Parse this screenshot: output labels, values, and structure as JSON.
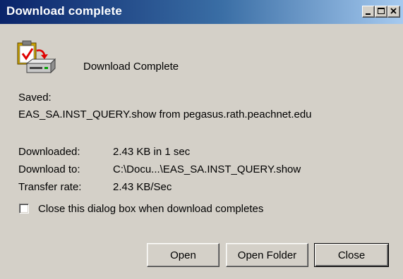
{
  "window": {
    "title": "Download complete"
  },
  "header": {
    "message": "Download Complete",
    "icon": "download-complete-icon"
  },
  "saved": {
    "label": "Saved:",
    "text": "EAS_SA.INST_QUERY.show from pegasus.rath.peachnet.edu"
  },
  "details": {
    "downloaded_label": "Downloaded:",
    "downloaded_value": "2.43 KB in 1 sec",
    "download_to_label": "Download to:",
    "download_to_value": "C:\\Docu...\\EAS_SA.INST_QUERY.show",
    "transfer_rate_label": "Transfer rate:",
    "transfer_rate_value": "2.43 KB/Sec"
  },
  "checkbox": {
    "label": "Close this dialog box when download completes",
    "checked": false
  },
  "buttons": {
    "open": "Open",
    "open_folder": "Open Folder",
    "close": "Close"
  },
  "colors": {
    "title_bar_start": "#0a246a",
    "title_bar_end": "#a6caf0",
    "dialog_background": "#d4d0c8"
  }
}
